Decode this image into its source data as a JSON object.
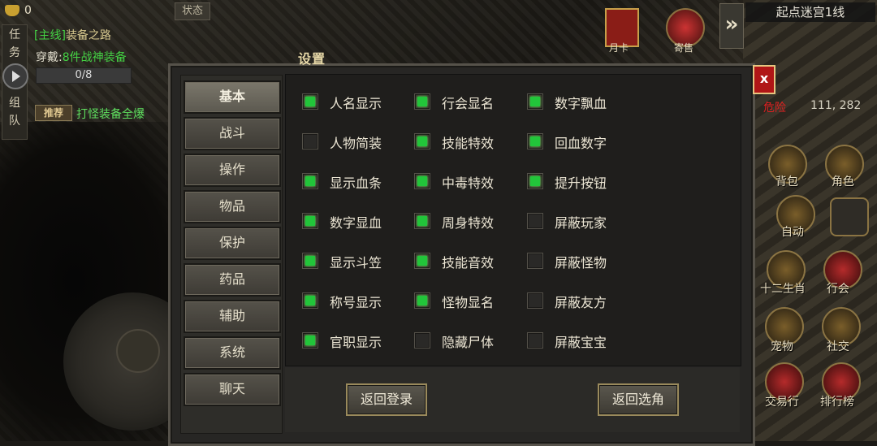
{
  "hud": {
    "gold_amount": "0",
    "status_tab": "状态",
    "left_tabs": [
      "任",
      "务",
      "组",
      "队"
    ],
    "quest_tag": "[主线]",
    "quest_name": "装备之路",
    "quest_req_label": "穿戴:",
    "quest_req_value": "8件战神装备",
    "quest_progress": "0/8",
    "recommend_badge": "推荐",
    "recommend_text": "打怪装备全爆"
  },
  "top_right": {
    "moon_card_label": "月卡",
    "consign_label": "寄售",
    "more_icon": "chevron-double-right-icon",
    "map_name": "起点迷宫1线",
    "danger_label": "危险",
    "coords": "111, 282"
  },
  "right_menu": [
    {
      "label": "背包",
      "icon": "bag-icon"
    },
    {
      "label": "角色",
      "icon": "character-icon"
    },
    {
      "label": "自动",
      "icon": "auto-battle-icon"
    },
    {
      "label": "",
      "icon": "grid-icon"
    },
    {
      "label": "十二生肖",
      "icon": "zodiac-icon"
    },
    {
      "label": "行会",
      "icon": "guild-icon"
    },
    {
      "label": "宠物",
      "icon": "pet-paw-icon"
    },
    {
      "label": "社交",
      "icon": "social-handshake-icon"
    },
    {
      "label": "交易行",
      "icon": "trade-icon"
    },
    {
      "label": "排行榜",
      "icon": "ranking-icon"
    }
  ],
  "dialog": {
    "title": "设置",
    "close_label": "x",
    "nav": [
      "基本",
      "战斗",
      "操作",
      "物品",
      "保护",
      "药品",
      "辅助",
      "系统",
      "聊天"
    ],
    "active_nav": "基本",
    "options": [
      [
        {
          "label": "人名显示",
          "checked": true
        },
        {
          "label": "人物简装",
          "checked": false
        },
        {
          "label": "显示血条",
          "checked": true
        },
        {
          "label": "数字显血",
          "checked": true
        },
        {
          "label": "显示斗笠",
          "checked": true
        },
        {
          "label": "称号显示",
          "checked": true
        },
        {
          "label": "官职显示",
          "checked": true
        }
      ],
      [
        {
          "label": "行会显名",
          "checked": true
        },
        {
          "label": "技能特效",
          "checked": true
        },
        {
          "label": "中毒特效",
          "checked": true
        },
        {
          "label": "周身特效",
          "checked": true
        },
        {
          "label": "技能音效",
          "checked": true
        },
        {
          "label": "怪物显名",
          "checked": true
        },
        {
          "label": "隐藏尸体",
          "checked": false
        }
      ],
      [
        {
          "label": "数字飘血",
          "checked": true
        },
        {
          "label": "回血数字",
          "checked": true
        },
        {
          "label": "提升按钮",
          "checked": true
        },
        {
          "label": "屏蔽玩家",
          "checked": false
        },
        {
          "label": "屏蔽怪物",
          "checked": false
        },
        {
          "label": "屏蔽友方",
          "checked": false
        },
        {
          "label": "屏蔽宝宝",
          "checked": false
        }
      ]
    ],
    "back_to_login": "返回登录",
    "back_to_select": "返回选角"
  }
}
